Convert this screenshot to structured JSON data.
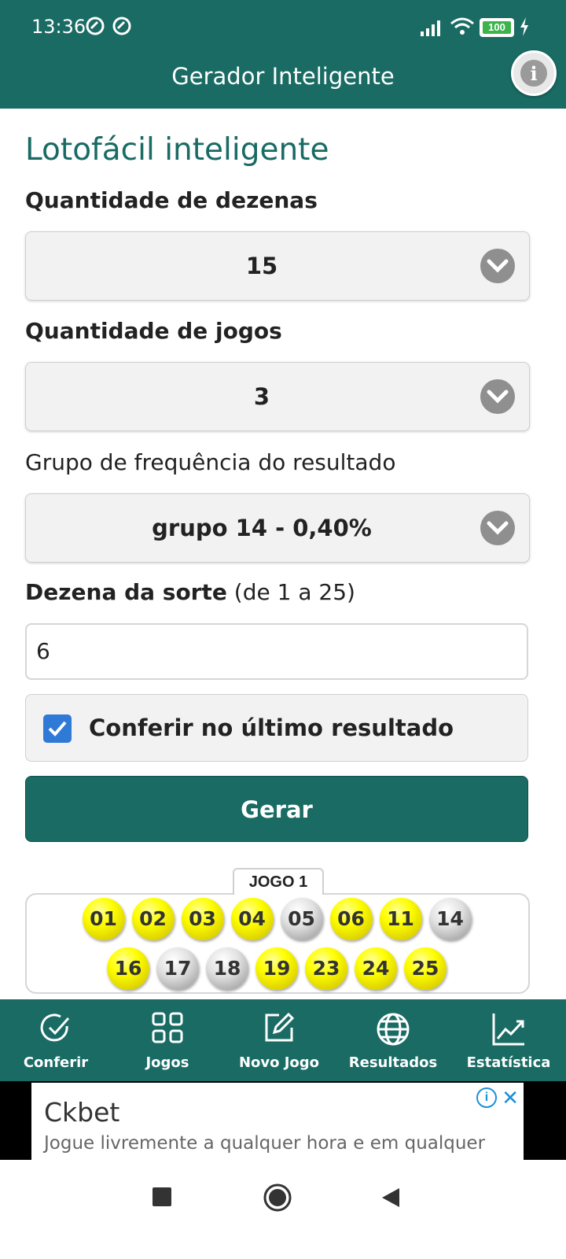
{
  "status_bar": {
    "time": "13:36",
    "battery": "100"
  },
  "app_bar": {
    "title": "Gerador Inteligente"
  },
  "main": {
    "title": "Lotofácil inteligente",
    "dezenas_label": "Quantidade de dezenas",
    "dezenas_value": "15",
    "jogos_label": "Quantidade de jogos",
    "jogos_value": "3",
    "grupo_label": "Grupo de frequência do resultado",
    "grupo_value": "grupo 14 - 0,40%",
    "sorte_label_bold": "Dezena da sorte",
    "sorte_label_rest": " (de 1 a 25)",
    "sorte_value": "6",
    "conferir_label": "Conferir no último resultado",
    "conferir_checked": true,
    "gerar_label": "Gerar"
  },
  "jogo": {
    "tag": "JOGO 1",
    "balls": [
      {
        "n": "01",
        "hit": true
      },
      {
        "n": "02",
        "hit": true
      },
      {
        "n": "03",
        "hit": true
      },
      {
        "n": "04",
        "hit": true
      },
      {
        "n": "05",
        "hit": false
      },
      {
        "n": "06",
        "hit": true
      },
      {
        "n": "11",
        "hit": true
      },
      {
        "n": "14",
        "hit": false
      },
      {
        "n": "16",
        "hit": true
      },
      {
        "n": "17",
        "hit": false
      },
      {
        "n": "18",
        "hit": false
      },
      {
        "n": "19",
        "hit": true
      },
      {
        "n": "23",
        "hit": true
      },
      {
        "n": "24",
        "hit": true
      },
      {
        "n": "25",
        "hit": true
      }
    ]
  },
  "bottom_nav": {
    "items": [
      {
        "label": "Conferir",
        "icon": "check-circle-icon"
      },
      {
        "label": "Jogos",
        "icon": "grid-icon"
      },
      {
        "label": "Novo Jogo",
        "icon": "edit-icon"
      },
      {
        "label": "Resultados",
        "icon": "globe-icon"
      },
      {
        "label": "Estatística",
        "icon": "chart-line-icon"
      }
    ]
  },
  "ad": {
    "title": "Ckbet",
    "text": "Jogue livremente a qualquer hora e em qualquer"
  },
  "colors": {
    "primary": "#196b64",
    "hit": "#ffff00",
    "miss": "#d9d9d9",
    "checkbox": "#2f7ad6"
  }
}
